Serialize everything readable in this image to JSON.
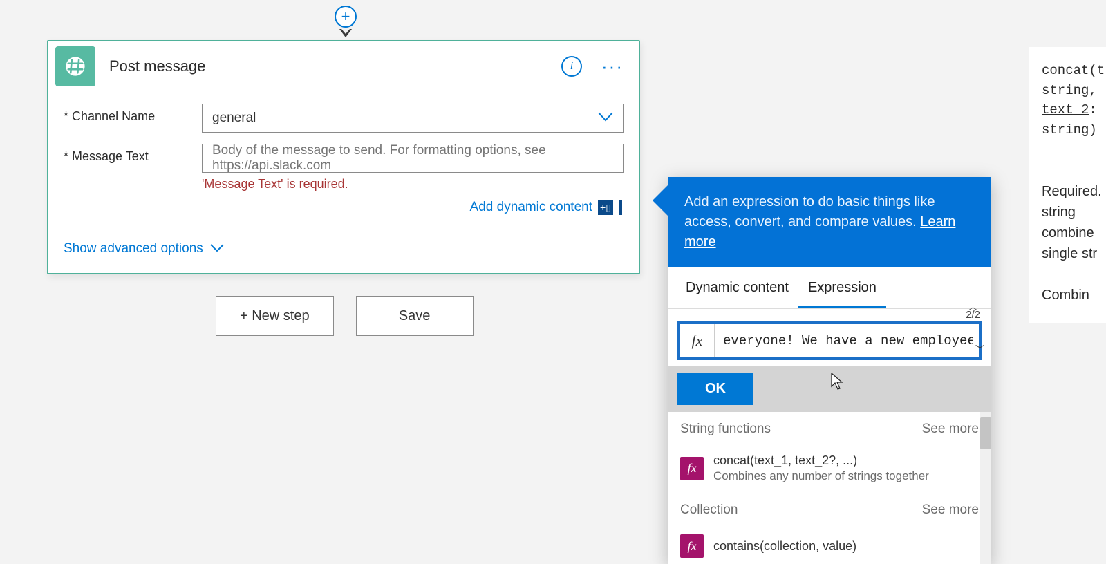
{
  "action": {
    "title": "Post message",
    "fields": {
      "channel": {
        "label": "Channel Name",
        "value": "general"
      },
      "message": {
        "label": "Message Text",
        "placeholder": "Body of the message to send. For formatting options, see https://api.slack.com",
        "error": "'Message Text' is required."
      }
    },
    "add_dynamic_content": "Add dynamic content",
    "show_advanced": "Show advanced options"
  },
  "buttons": {
    "new_step": "+ New step",
    "save": "Save"
  },
  "expression_popup": {
    "header_text": "Add an expression to do basic things like access, convert, and compare values. ",
    "learn_more": "Learn more",
    "tabs": {
      "dynamic": "Dynamic content",
      "expression": "Expression"
    },
    "counter": "2/2",
    "fx_label": "fx",
    "input_value": "everyone! We have a new employee: ', )",
    "ok": "OK",
    "sections": [
      {
        "name": "String functions",
        "see_more": "See more",
        "items": [
          {
            "title": "concat(text_1, text_2?, ...)",
            "desc": "Combines any number of strings together"
          }
        ]
      },
      {
        "name": "Collection",
        "see_more": "See more",
        "items": [
          {
            "title": "contains(collection, value)",
            "desc": ""
          }
        ]
      }
    ]
  },
  "doc_panel": {
    "sig_line1": "concat(t",
    "sig_line2": "string,",
    "sig_line3": "text_2",
    "sig_line3_suffix": ":",
    "sig_line4": "string)",
    "req1": "Required.",
    "req2": "string",
    "req3": "combine",
    "req4": "single str",
    "combine": "Combin"
  }
}
